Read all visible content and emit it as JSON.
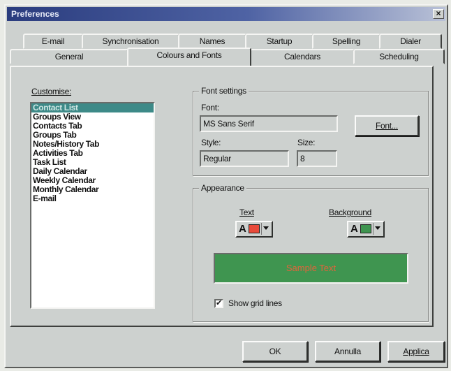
{
  "window": {
    "title": "Preferences",
    "close_glyph": "×"
  },
  "tabs_back": [
    "E-mail",
    "Synchronisation",
    "Names",
    "Startup",
    "Spelling",
    "Dialer"
  ],
  "tabs_front": [
    "General",
    "Colours and Fonts",
    "Calendars",
    "Scheduling"
  ],
  "active_tab": "Colours and Fonts",
  "customise": {
    "label": "Customise:",
    "items": [
      "Contact List",
      "Groups View",
      "Contacts Tab",
      "Groups Tab",
      "Notes/History Tab",
      "Activities Tab",
      "Task List",
      "Daily Calendar",
      "Weekly Calendar",
      "Monthly Calendar",
      "E-mail"
    ],
    "selected": "Contact List"
  },
  "font_settings": {
    "title": "Font settings",
    "font_label": "Font:",
    "font_value": "MS Sans Serif",
    "font_button": "Font...",
    "style_label": "Style:",
    "style_value": "Regular",
    "size_label": "Size:",
    "size_value": "8"
  },
  "appearance": {
    "title": "Appearance",
    "text_label": "Text",
    "background_label": "Background",
    "text_color": "#e84a3a",
    "background_color": "#3f9550",
    "color_glyph": "A",
    "sample_text": "Sample Text",
    "show_grid_lines_label": "Show grid lines",
    "show_grid_lines_checked": true,
    "check_glyph": "✔"
  },
  "buttons": {
    "ok": "OK",
    "cancel": "Annulla",
    "apply": "Applica"
  },
  "icons": {
    "close": "close-icon",
    "dropdown": "chevron-down-icon",
    "font_color": "font-color-icon"
  }
}
